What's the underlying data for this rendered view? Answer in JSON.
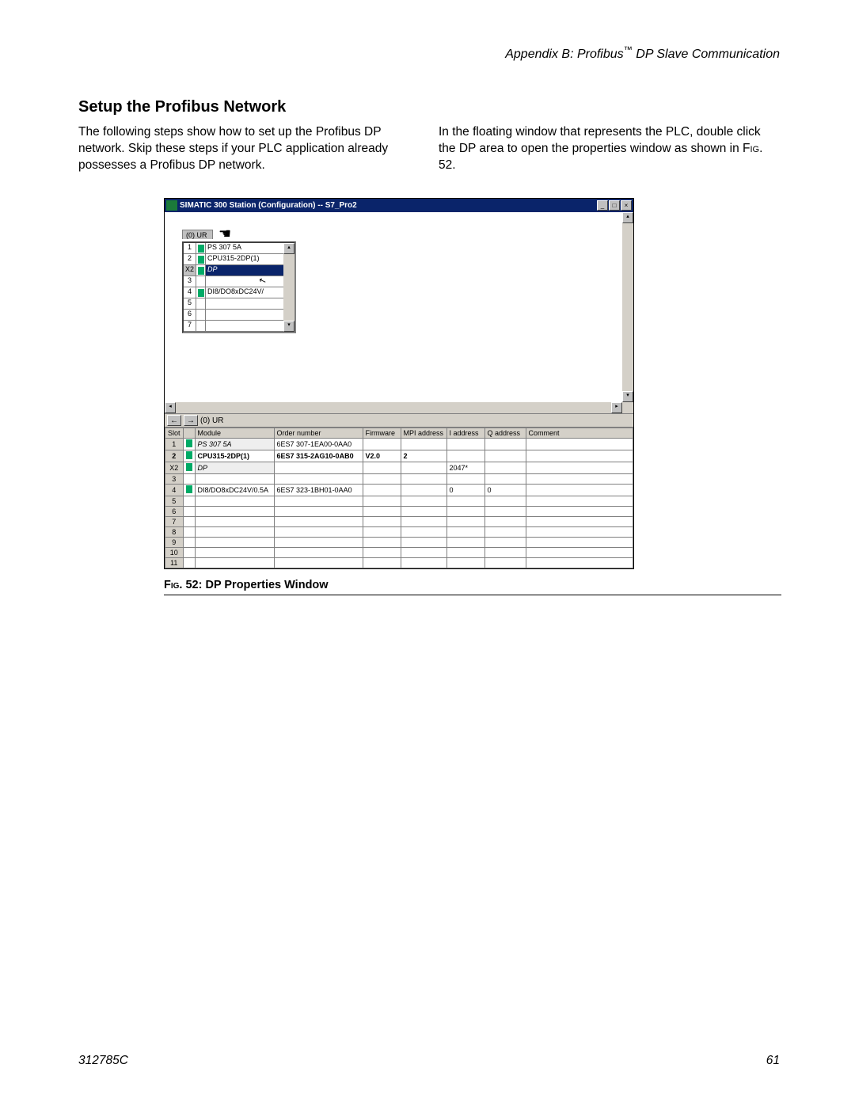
{
  "header": {
    "appendix": "Appendix B: Profibus™ DP Slave Communication"
  },
  "section": {
    "title": "Setup the Profibus Network"
  },
  "body": {
    "col1": "The following steps show how to set up the Profibus DP network. Skip these steps if your PLC application already possesses a Profibus DP network.",
    "col2_a": "In the floating window that represents the PLC, double click the DP area to open the properties window as shown in ",
    "col2_figref": "Fig",
    "col2_b": ". 52."
  },
  "screenshot": {
    "title": "SIMATIC 300 Station (Configuration) -- S7_Pro2",
    "win_min": "_",
    "win_max": "□",
    "win_close": "×",
    "rack_tab": "(0) UR",
    "rack_rows": [
      {
        "n": "1",
        "module": "PS 307 5A",
        "icon": true
      },
      {
        "n": "2",
        "module": "CPU315-2DP(1)",
        "icon": true
      },
      {
        "n": "X2",
        "module": "DP",
        "icon": true,
        "sel": true
      },
      {
        "n": "3",
        "module": "",
        "icon": false
      },
      {
        "n": "4",
        "module": "DI8/DO8xDC24V/",
        "icon": true
      },
      {
        "n": "5",
        "module": "",
        "icon": false
      },
      {
        "n": "6",
        "module": "",
        "icon": false
      },
      {
        "n": "7",
        "module": "",
        "icon": false
      }
    ],
    "nav_label": "(0)  UR",
    "table_headers": [
      "Slot",
      "",
      "Module",
      "Order number",
      "Firmware",
      "MPI address",
      "I address",
      "Q address",
      "Comment"
    ],
    "table_rows": [
      {
        "slot": "1",
        "icon": true,
        "module": "PS 307 5A",
        "order": "6ES7 307-1EA00-0AA0",
        "fw": "",
        "mpi": "",
        "iaddr": "",
        "qaddr": "",
        "comment": "",
        "hl": true
      },
      {
        "slot": "2",
        "icon": true,
        "module": "CPU315-2DP(1)",
        "order": "6ES7 315-2AG10-0AB0",
        "fw": "V2.0",
        "mpi": "2",
        "iaddr": "",
        "qaddr": "",
        "comment": "",
        "bold": true
      },
      {
        "slot": "X2",
        "icon": true,
        "module": "DP",
        "order": "",
        "fw": "",
        "mpi": "",
        "iaddr": "2047*",
        "qaddr": "",
        "comment": "",
        "hl": true
      },
      {
        "slot": "3",
        "icon": false,
        "module": "",
        "order": "",
        "fw": "",
        "mpi": "",
        "iaddr": "",
        "qaddr": "",
        "comment": ""
      },
      {
        "slot": "4",
        "icon": true,
        "module": "DI8/DO8xDC24V/0.5A",
        "order": "6ES7 323-1BH01-0AA0",
        "fw": "",
        "mpi": "",
        "iaddr": "0",
        "qaddr": "0",
        "comment": ""
      },
      {
        "slot": "5",
        "icon": false,
        "module": "",
        "order": "",
        "fw": "",
        "mpi": "",
        "iaddr": "",
        "qaddr": "",
        "comment": ""
      },
      {
        "slot": "6",
        "icon": false,
        "module": "",
        "order": "",
        "fw": "",
        "mpi": "",
        "iaddr": "",
        "qaddr": "",
        "comment": ""
      },
      {
        "slot": "7",
        "icon": false,
        "module": "",
        "order": "",
        "fw": "",
        "mpi": "",
        "iaddr": "",
        "qaddr": "",
        "comment": ""
      },
      {
        "slot": "8",
        "icon": false,
        "module": "",
        "order": "",
        "fw": "",
        "mpi": "",
        "iaddr": "",
        "qaddr": "",
        "comment": ""
      },
      {
        "slot": "9",
        "icon": false,
        "module": "",
        "order": "",
        "fw": "",
        "mpi": "",
        "iaddr": "",
        "qaddr": "",
        "comment": ""
      },
      {
        "slot": "10",
        "icon": false,
        "module": "",
        "order": "",
        "fw": "",
        "mpi": "",
        "iaddr": "",
        "qaddr": "",
        "comment": ""
      },
      {
        "slot": "11",
        "icon": false,
        "module": "",
        "order": "",
        "fw": "",
        "mpi": "",
        "iaddr": "",
        "qaddr": "",
        "comment": ""
      }
    ]
  },
  "figure": {
    "caption_prefix": "Fig. 52: ",
    "caption": "DP Properties Window"
  },
  "footer": {
    "docnum": "312785C",
    "pagenum": "61"
  }
}
